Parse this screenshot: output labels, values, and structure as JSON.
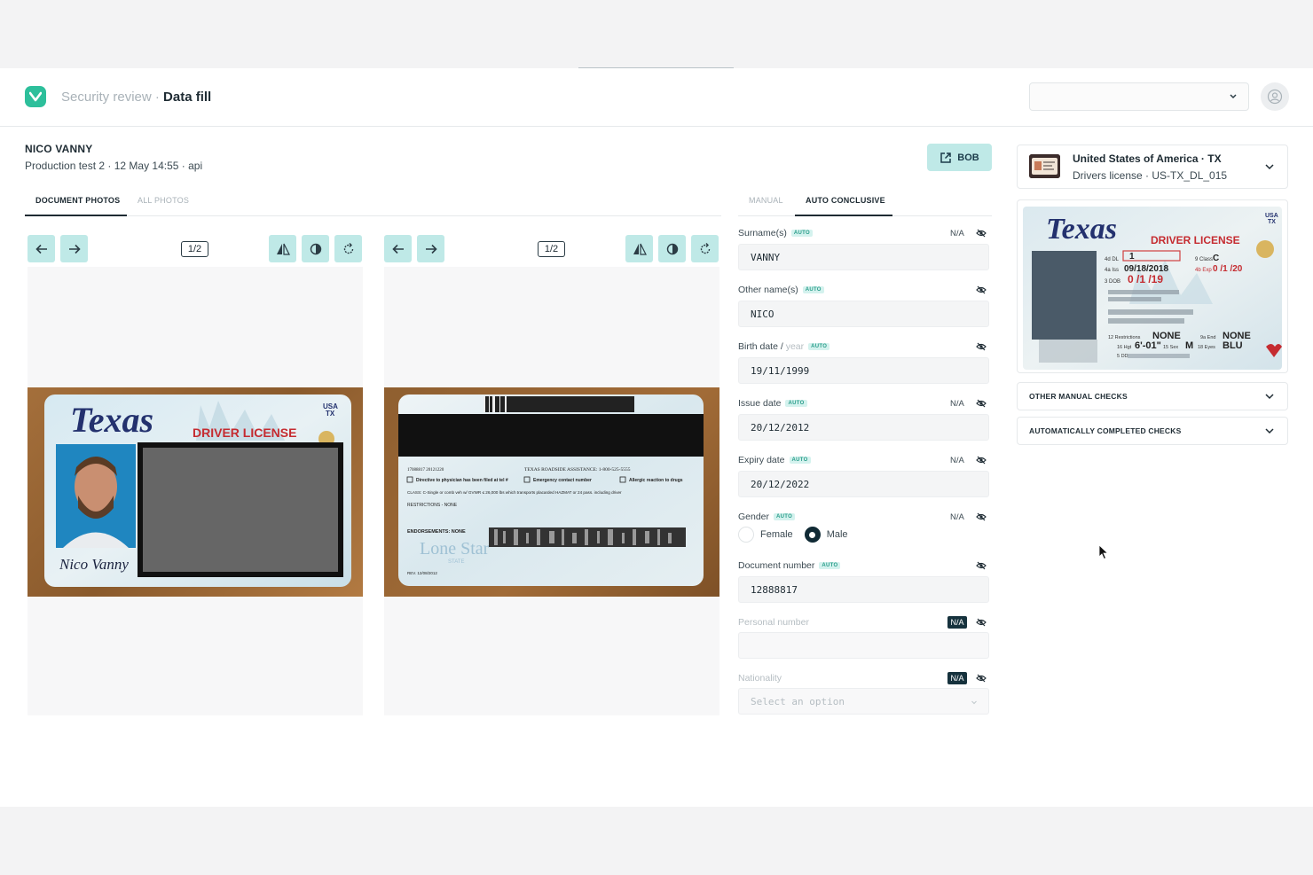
{
  "header": {
    "section": "Security review",
    "separator": "·",
    "page": "Data fill",
    "select_value": ""
  },
  "subject": {
    "name": "NICO VANNY",
    "meta": "Production test 2 · 12 May 14:55 · api",
    "bob_label": "BOB"
  },
  "photo_tabs": [
    {
      "label": "DOCUMENT PHOTOS",
      "active": true
    },
    {
      "label": "ALL PHOTOS",
      "active": false
    }
  ],
  "viewers": [
    {
      "page": "1/2",
      "side": "front"
    },
    {
      "page": "1/2",
      "side": "back"
    }
  ],
  "card_front": {
    "state": "Texas",
    "type": "DRIVER LICENSE",
    "country": "USA",
    "state_code": "TX",
    "signature": "Nico Vanny"
  },
  "card_back": {
    "header_left": "17088817 20121220",
    "header_right": "TEXAS ROADSIDE ASSISTANCE: 1-800-525-5555",
    "line1": "Directive to physician has been filed at tel #",
    "line2": "Emergency contact number",
    "line3": "Allergic reaction to drugs",
    "class_text": "CLASS: C-Single or comb veh w/ GVWR ≤ 26,000 lbs which transports placarded HAZMAT or 24 pass. including driver",
    "restrictions": "RESTRICTIONS - NONE",
    "endorsements": "ENDORSEMENTS: NONE",
    "lone_star": "Lone Star",
    "lone_star_sub": "STATE",
    "rev": "REV. 12/08/2012"
  },
  "form_tabs": [
    {
      "label": "MANUAL",
      "active": false
    },
    {
      "label": "AUTO CONCLUSIVE",
      "active": true
    }
  ],
  "auto_label": "AUTO",
  "na_label": "N/A",
  "fields": {
    "surname": {
      "label": "Surname(s)",
      "value": "VANNY",
      "na": "N/A"
    },
    "other_names": {
      "label": "Other name(s)",
      "value": "NICO"
    },
    "birth_date": {
      "label": "Birth date / ",
      "label_suffix": "year",
      "value": "19/11/1999"
    },
    "issue_date": {
      "label": "Issue date",
      "value": "20/12/2012",
      "na": "N/A"
    },
    "expiry_date": {
      "label": "Expiry date",
      "value": "20/12/2022",
      "na": "N/A"
    },
    "gender": {
      "label": "Gender",
      "options": [
        "Female",
        "Male"
      ],
      "selected": "Male",
      "na": "N/A"
    },
    "document_number": {
      "label": "Document number",
      "value": "12888817"
    },
    "personal_number": {
      "label": "Personal number",
      "value": "",
      "na": "N/A"
    },
    "nationality": {
      "label": "Nationality",
      "placeholder": "Select an option",
      "na": "N/A"
    }
  },
  "document_type": {
    "title": "United States of America · TX",
    "subtitle": "Drivers license · US-TX_DL_015"
  },
  "reference_card": {
    "state": "Texas",
    "type": "DRIVER LICENSE",
    "country": "USA",
    "state_code": "TX",
    "dl_number": "1",
    "dl_prefix": "4d DL",
    "class_label": "9 Class",
    "class_value": "C",
    "iss_label": "4a Iss",
    "iss_value": "09/18/2018",
    "exp_label": "4b Exp",
    "exp_value": "0 /1 /20",
    "dob_label": "3 DOB",
    "dob_value": "0 /1 /19",
    "restr_label": "12 Restrictions",
    "restr_value": "NONE",
    "end_label": "9a End",
    "end_value": "NONE",
    "hgt_label": "16 Hgt",
    "hgt_value": "6'-01\"",
    "sex_label": "15 Sex",
    "sex_value": "M",
    "eyes_label": "18 Eyes",
    "eyes_value": "BLU",
    "dd_label": "5 DD"
  },
  "accordions": [
    {
      "label": "OTHER MANUAL CHECKS"
    },
    {
      "label": "AUTOMATICALLY COMPLETED CHECKS"
    }
  ],
  "colors": {
    "accent": "#2dbf9b",
    "button_bg": "#bfe9e7",
    "dark": "#16323d"
  }
}
